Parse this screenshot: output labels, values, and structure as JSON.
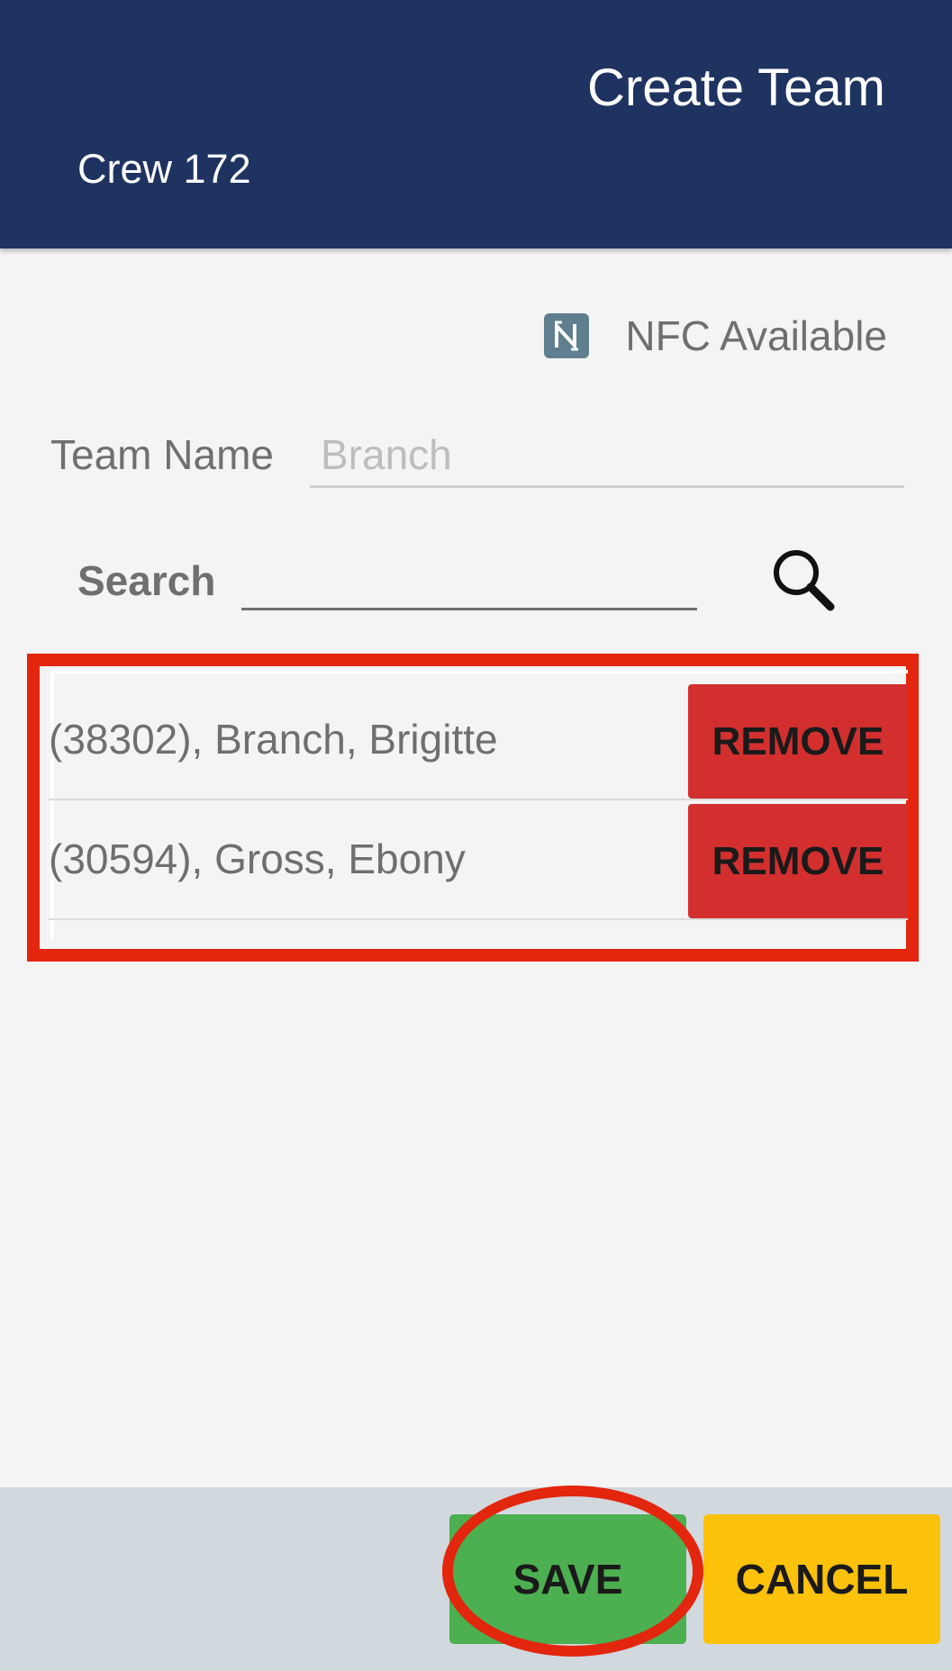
{
  "header": {
    "title": "Create Team",
    "subtitle": "Crew 172"
  },
  "nfc": {
    "icon": "nfc-icon",
    "label": "NFC Available"
  },
  "team_name": {
    "label": "Team Name",
    "placeholder": "Branch"
  },
  "search": {
    "label": "Search",
    "value": "",
    "icon": "search-icon"
  },
  "members": [
    {
      "name": "(38302), Branch, Brigitte",
      "action": "REMOVE"
    },
    {
      "name": "(30594), Gross, Ebony",
      "action": "REMOVE"
    }
  ],
  "footer": {
    "save_label": "SAVE",
    "cancel_label": "CANCEL"
  },
  "colors": {
    "header_bg": "#1f3361",
    "remove": "#d32f2f",
    "save": "#4caf50",
    "cancel": "#fcc10b",
    "highlight": "#e3260e"
  }
}
